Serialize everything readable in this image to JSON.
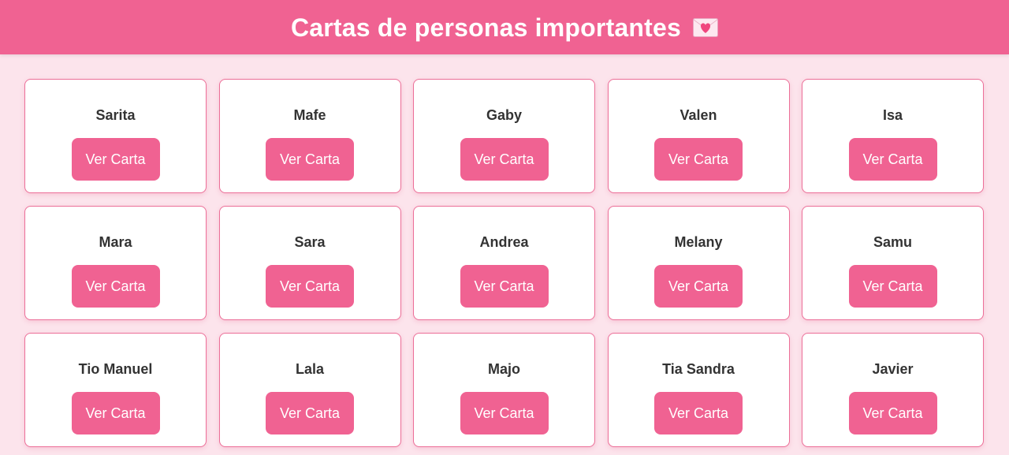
{
  "header": {
    "title": "Cartas de personas importantes",
    "icon": "love-letter-icon"
  },
  "colors": {
    "header_bg": "#f06292",
    "page_bg": "#fce4ec",
    "button_bg": "#f06292",
    "card_border": "#ec6f98"
  },
  "cards": [
    {
      "name": "Sarita",
      "button": "Ver Carta"
    },
    {
      "name": "Mafe",
      "button": "Ver Carta"
    },
    {
      "name": "Gaby",
      "button": "Ver Carta"
    },
    {
      "name": "Valen",
      "button": "Ver Carta"
    },
    {
      "name": "Isa",
      "button": "Ver Carta"
    },
    {
      "name": "Mara",
      "button": "Ver Carta"
    },
    {
      "name": "Sara",
      "button": "Ver Carta"
    },
    {
      "name": "Andrea",
      "button": "Ver Carta"
    },
    {
      "name": "Melany",
      "button": "Ver Carta"
    },
    {
      "name": "Samu",
      "button": "Ver Carta"
    },
    {
      "name": "Tio Manuel",
      "button": "Ver Carta"
    },
    {
      "name": "Lala",
      "button": "Ver Carta"
    },
    {
      "name": "Majo",
      "button": "Ver Carta"
    },
    {
      "name": "Tia Sandra",
      "button": "Ver Carta"
    },
    {
      "name": "Javier",
      "button": "Ver Carta"
    }
  ]
}
